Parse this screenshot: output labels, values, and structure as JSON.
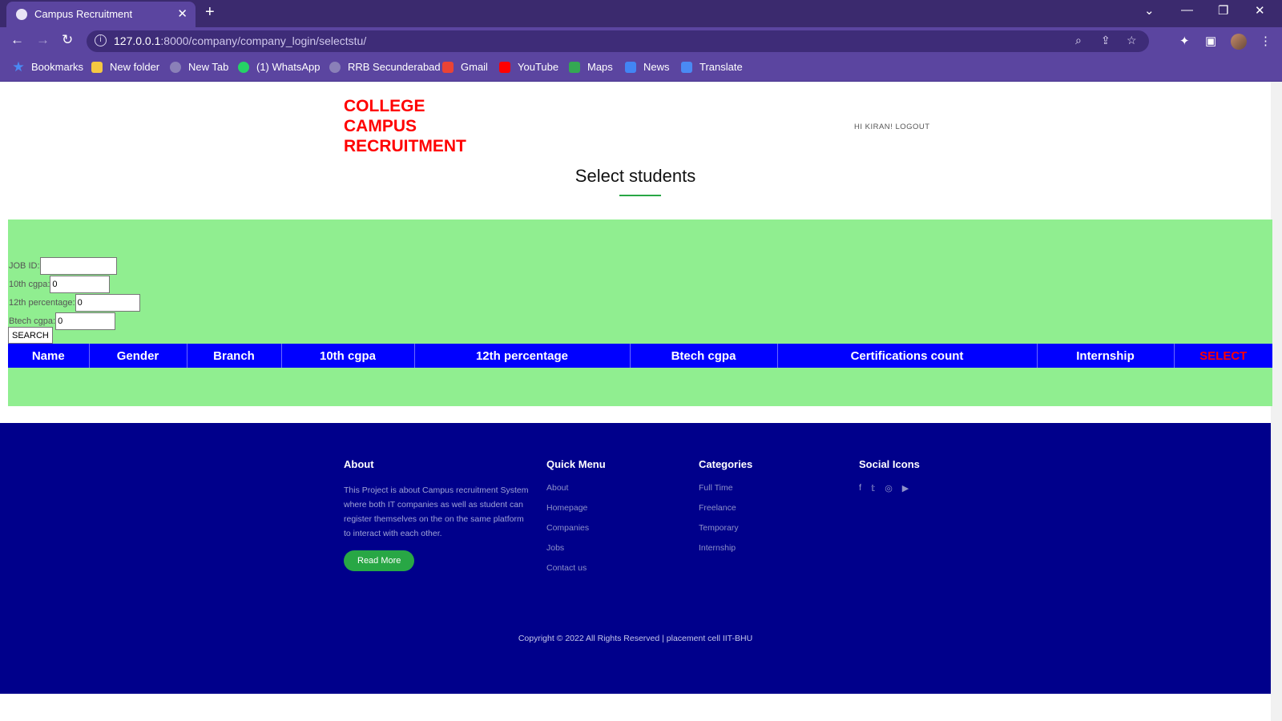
{
  "browser": {
    "tab_title": "Campus Recruitment",
    "url_host": "127.0.0.1",
    "url_rest": ":8000/company/company_login/selectstu/",
    "bookmarks": [
      "Bookmarks",
      "New folder",
      "New Tab",
      "(1) WhatsApp",
      "RRB Secunderabad",
      "Gmail",
      "YouTube",
      "Maps",
      "News",
      "Translate"
    ]
  },
  "header": {
    "brand_line1": "COLLEGE",
    "brand_line2": "CAMPUS",
    "brand_line3": "RECRUITMENT",
    "user_text": "HI KIRAN! LOGOUT"
  },
  "main": {
    "heading": "Select students",
    "form": {
      "job_id_label": "JOB ID:",
      "job_id_value": "",
      "tenth_label": "10th cgpa:",
      "tenth_value": "0",
      "twelfth_label": "12th percentage:",
      "twelfth_value": "0",
      "btech_label": "Btech cgpa:",
      "btech_value": "0",
      "search_label": "SEARCH"
    },
    "table_headers": [
      "Name",
      "Gender",
      "Branch",
      "10th cgpa",
      "12th percentage",
      "Btech cgpa",
      "Certifications count",
      "Internship",
      "SELECT"
    ]
  },
  "footer": {
    "about_title": "About",
    "about_text": "This Project is about Campus recruitment System where both IT companies as well as student can register themselves on the on the same platform to interact with each other.",
    "read_more": "Read More",
    "quick_title": "Quick Menu",
    "quick_items": [
      "About",
      "Homepage",
      "Companies",
      "Jobs",
      "Contact us"
    ],
    "categories_title": "Categories",
    "categories_items": [
      "Full Time",
      "Freelance",
      "Temporary",
      "Internship"
    ],
    "social_title": "Social Icons",
    "social_icons": [
      "facebook-icon",
      "twitter-icon",
      "instagram-icon",
      "youtube-icon"
    ],
    "copyright": "Copyright © 2022 All Rights Reserved | placement cell IIT-BHU"
  },
  "colors": {
    "brand": "#ff0000",
    "panel": "#90ee90",
    "table_header": "#0000ff",
    "footer": "#00008b",
    "accent": "#28a745"
  }
}
